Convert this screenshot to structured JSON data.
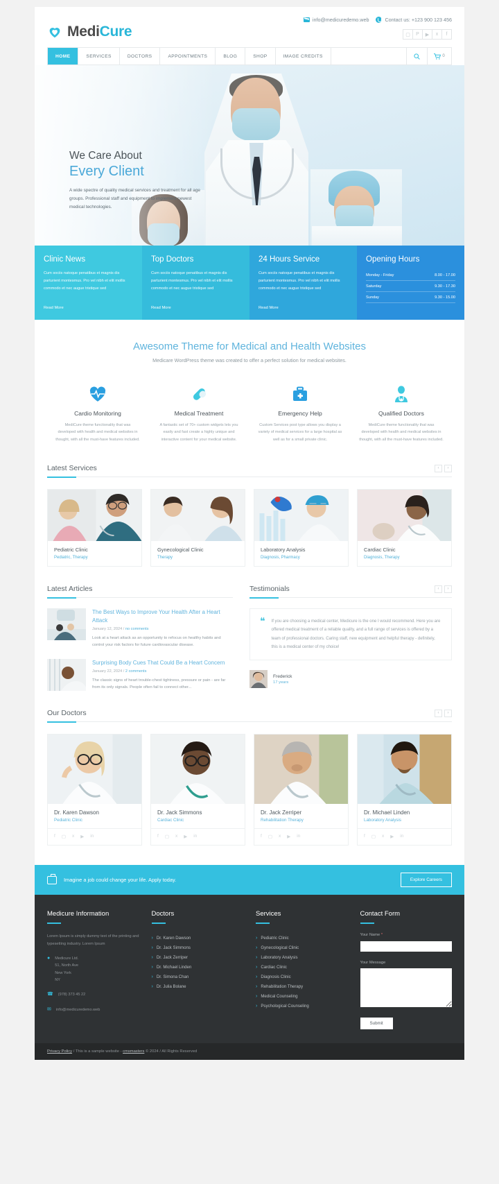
{
  "header": {
    "logo_text_1": "Medi",
    "logo_text_2": "Cure",
    "email": "info@medicuredemo.web",
    "phone": "Contact us: +123 900 123 456",
    "socials": [
      "instagram",
      "pinterest",
      "youtube",
      "x",
      "facebook"
    ]
  },
  "nav": {
    "items": [
      "HOME",
      "SERVICES",
      "DOCTORS",
      "APPOINTMENTS",
      "BLOG",
      "SHOP",
      "IMAGE CREDITS"
    ],
    "active": "HOME",
    "search_placeholder": "",
    "cart_count": "0"
  },
  "hero": {
    "title_line1": "We Care About",
    "title_line2": "Every Client",
    "paragraph": "A wide spectre of quality medical services and treatment for all age groups. Professional staff and equipment to implement newest medical technologies."
  },
  "infoboxes": [
    {
      "title": "Clinic News",
      "text": "Cum sociis natoque penatibus et magnis dis parturient montesmus. Pro vel nibh et elit mollis commodo et nec augue tristique sed",
      "link": "Read More"
    },
    {
      "title": "Top Doctors",
      "text": "Cum sociis natoque penatibus et magnis dis parturient montesmus. Pro vel nibh et elit mollis commodo et nec augue tristique sed",
      "link": "Read More"
    },
    {
      "title": "24 Hours Service",
      "text": "Cum sociis natoque penatibus et magnis dis parturient montesmus. Pro vel nibh et elit mollis commodo et nec augue tristique sed",
      "link": "Read More"
    }
  ],
  "opening_hours": {
    "title": "Opening Hours",
    "rows": [
      {
        "day": "Monday - Friday",
        "time": "8.00 - 17.00"
      },
      {
        "day": "Saturday",
        "time": "9.30 - 17.30"
      },
      {
        "day": "Sunday",
        "time": "9.30 - 15.00"
      }
    ]
  },
  "awesome": {
    "title": "Awesome Theme for Medical and Health Websites",
    "subtitle": "Medicare WordPress theme was created to offer a perfect solution for medical websites."
  },
  "features": [
    {
      "icon": "heart-pulse-icon",
      "title": "Cardio Monitoring",
      "text": "MediCure theme functionality that was developed with health and medical websites in thought, with all the must-have features included."
    },
    {
      "icon": "pill-icon",
      "title": "Medical Treatment",
      "text": "A fantastic set of 70+ custom widgets lets you easily and fast create a highly unique and interactive content for your medical website."
    },
    {
      "icon": "first-aid-kit-icon",
      "title": "Emergency Help",
      "text": "Custom Services post type allows you display a variety of medical services for a large hospital as well as for a small private clinic."
    },
    {
      "icon": "doctor-avatar-icon",
      "title": "Qualified Doctors",
      "text": "MediCure theme functionality that was developed with health and medical websites in thought, with all the must-have features included."
    }
  ],
  "latest_services": {
    "title": "Latest Services",
    "cards": [
      {
        "title": "Pediatric Clinic",
        "tags": "Pediatric,  Therapy"
      },
      {
        "title": "Gynecological Clinic",
        "tags": "Therapy"
      },
      {
        "title": "Laboratory Analysis",
        "tags": "Diagnosis,  Pharmacy"
      },
      {
        "title": "Cardiac Clinic",
        "tags": "Diagnosis,  Therapy"
      }
    ]
  },
  "latest_articles": {
    "title": "Latest Articles",
    "items": [
      {
        "title": "The Best Ways to Improve Your Health After a Heart Attack",
        "date": "January 12, 2024",
        "comments": "no comments",
        "excerpt": "Look at a heart attack as an opportunity to refocus on healthy habits and control your risk factors for future cardiovascular disease."
      },
      {
        "title": "Surprising Body Cues That Could Be a Heart Concern",
        "date": "January 22, 2024",
        "comments": "2 comments",
        "excerpt": "The classic signs of heart trouble-chest tightness, pressure or pain - are far from its only signals. People often fail to connect other..."
      }
    ]
  },
  "testimonials": {
    "title": "Testimonials",
    "quote": "If you are choosing a medical center, Medicure is the one I would recommend. Here you are offered medical treatment of a reliable quality, and a full range of services is offered by a team of professional doctors. Caring staff, new equipment and helpful therapy - definitely, this is a medical center of my choice!",
    "author": "Frederick",
    "role": "17 years"
  },
  "our_doctors": {
    "title": "Our Doctors",
    "socials": [
      "facebook",
      "instagram",
      "x",
      "youtube",
      "linkedin"
    ],
    "items": [
      {
        "name": "Dr. Karen Dawson",
        "role": "Pediatric Clinic"
      },
      {
        "name": "Dr. Jack Simmons",
        "role": "Cardiac Clinic"
      },
      {
        "name": "Dr. Jack Zerriper",
        "role": "Rehabilitation Therapy"
      },
      {
        "name": "Dr. Michael Linden",
        "role": "Laboratory Analysis"
      }
    ]
  },
  "careers": {
    "text": "Imagine a job could change your life. Apply today.",
    "button": "Explore Careers"
  },
  "footer": {
    "info": {
      "title": "Medicure Information",
      "text": "Lorem Ipsum is simply dummy text of the printing and typesetting industry. Lorem Ipsum",
      "address_line1": "Medicure Ltd.",
      "address_line2": "51, North Ave",
      "address_line3": "New York",
      "address_line4": "NY",
      "phone": "(978) 373 45 22",
      "email": "info@medicuredemo.web"
    },
    "doctors": {
      "title": "Doctors",
      "items": [
        "Dr. Karen Dawson",
        "Dr. Jack Simmons",
        "Dr. Jack Zerriper",
        "Dr. Michael Linden",
        "Dr. Simona Chan",
        "Dr. Julia Bolane"
      ]
    },
    "services": {
      "title": "Services",
      "items": [
        "Pediatric Clinic",
        "Gynecological Clinic",
        "Laboratory Analysis",
        "Cardiac Clinic",
        "Diagnosis Clinic",
        "Rehabilitation Therapy",
        "Medical Counseling",
        "Psychological Counseling"
      ]
    },
    "contact_form": {
      "title": "Contact Form",
      "name_label": "Your Name",
      "name_required": "*",
      "name_value": "",
      "message_label": "Your Message",
      "message_value": "",
      "submit": "Submit"
    },
    "copyright_prefix": "Privacy Policy",
    "copyright_mid": "/ This is a sample website - ",
    "copyright_link2": "cmsmasters",
    "copyright_suffix": " © 2024 / All Rights Reserved"
  }
}
